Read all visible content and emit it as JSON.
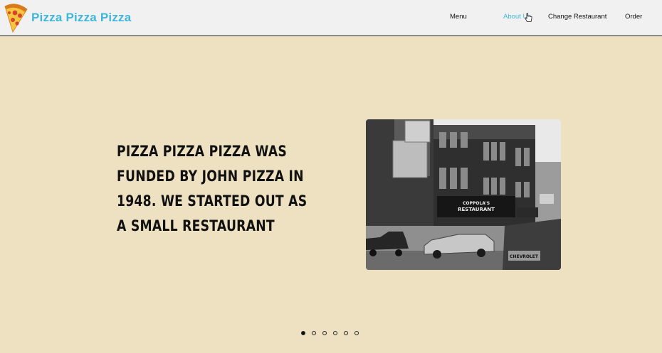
{
  "header": {
    "brand_name": "Pizza Pizza Pizza",
    "brand_color": "#3fb6dc",
    "logo_icon": "pizza-slice-icon",
    "nav": [
      {
        "label": "Menu",
        "active": false
      },
      {
        "label": "About Us",
        "active": true
      },
      {
        "label": "Change Restaurant",
        "active": false
      },
      {
        "label": "Order",
        "active": false
      }
    ]
  },
  "slide": {
    "headline": "Pizza Pizza Pizza was funded by John Pizza in 1948. We started out as a small restaurant",
    "photo": {
      "sign_text": "COPPOLA'S RESTAURANT",
      "truck_text": "CHEVROLET"
    }
  },
  "carousel": {
    "dot_count": 6,
    "active_index": 0
  },
  "colors": {
    "background": "#ede1c2",
    "header_bg": "#f1f1f1",
    "active_nav": "#3fb6dc"
  }
}
